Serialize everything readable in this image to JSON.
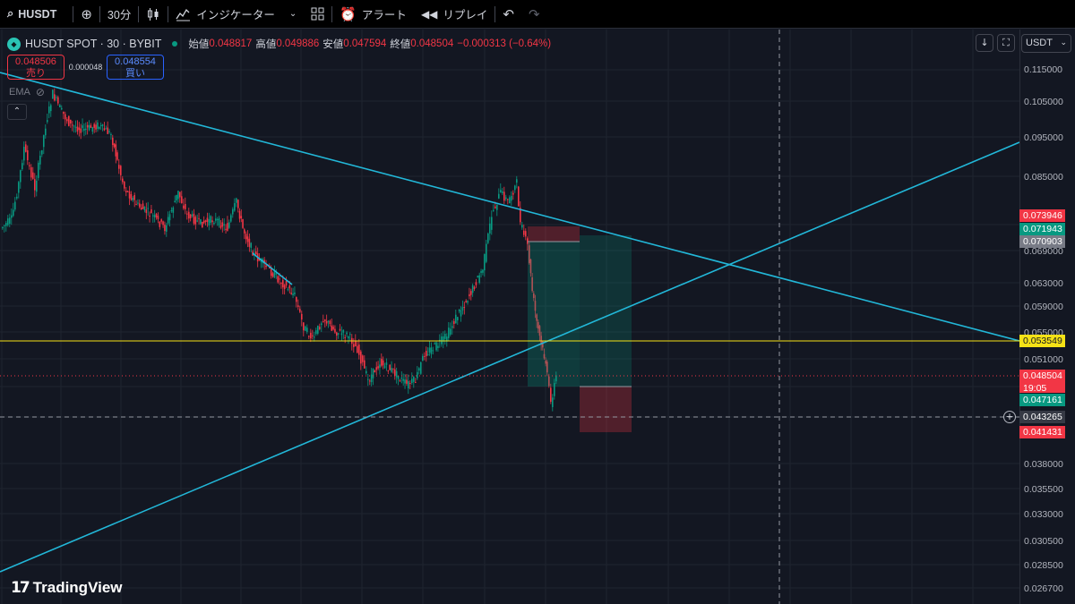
{
  "toolbar": {
    "symbol": "HUSDT",
    "interval": "30分",
    "indicators_label": "インジケーター",
    "alert_label": "アラート",
    "replay_label": "リプレイ"
  },
  "legend": {
    "title": "HUSDT SPOT · 30 · BYBIT",
    "open_label": "始値",
    "open": "0.048817",
    "high_label": "高値",
    "high": "0.049886",
    "low_label": "安値",
    "low": "0.047594",
    "close_label": "終値",
    "close": "0.048504",
    "change": "−0.000313 (−0.64%)"
  },
  "trade": {
    "sell_price": "0.048506",
    "sell_label": "売り",
    "spread": "0.000048",
    "buy_price": "0.048554",
    "buy_label": "買い"
  },
  "indicator": {
    "name": "EMA"
  },
  "currency": {
    "label": "USDT"
  },
  "watermark": {
    "text": "TradingView"
  },
  "price_scale": {
    "ticks": [
      "0.115000",
      "0.105000",
      "0.095000",
      "0.085000",
      "0.069000",
      "0.063000",
      "0.059000",
      "0.055000",
      "0.051000",
      "0.038000",
      "0.035500",
      "0.033000",
      "0.030500",
      "0.028500",
      "0.026700"
    ],
    "badges": [
      {
        "value": "0.073946",
        "color": "#f23645"
      },
      {
        "value": "0.071943",
        "color": "#089981"
      },
      {
        "value": "0.070903",
        "color": "#787b86"
      },
      {
        "value": "0.053549",
        "color": "#f5e216"
      },
      {
        "value": "0.048504",
        "sub": "19:05",
        "color": "#f23645"
      },
      {
        "value": "0.047161",
        "color": "#089981"
      },
      {
        "value": "0.043265",
        "color": "#363a45"
      },
      {
        "value": "0.041431",
        "color": "#f23645"
      }
    ]
  },
  "colors": {
    "background": "#131722",
    "up": "#089981",
    "down": "#f23645",
    "trendline": "#22b7d8",
    "horizontal": "#f5e216"
  }
}
